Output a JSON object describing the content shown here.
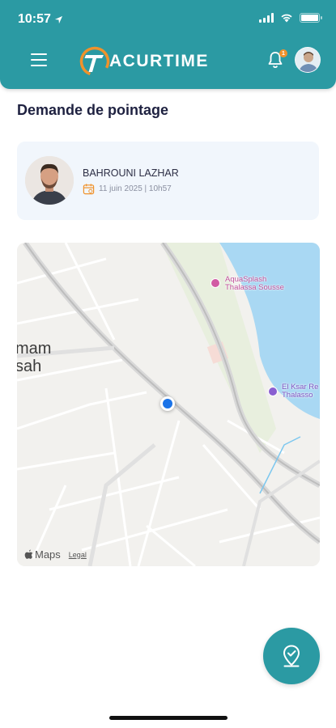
{
  "status_bar": {
    "time": "10:57"
  },
  "header": {
    "logo_text": "ACURTIME",
    "notification_count": "1"
  },
  "page": {
    "title": "Demande de pointage"
  },
  "user": {
    "name": "BAHROUNI LAZHAR",
    "datetime": "11 juin 2025 | 10h57"
  },
  "map": {
    "place_label_line1": "mam",
    "place_label_line2": "sah",
    "poi_1_line1": "AquaSplash",
    "poi_1_line2": "Thalassa Sousse",
    "poi_2_line1": "El Ksar Re",
    "poi_2_line2": "Thalasso",
    "brand": "Maps",
    "legal": "Legal"
  },
  "colors": {
    "primary": "#2b9aa3",
    "accent": "#f0922b",
    "location": "#1a73e8",
    "water": "#a9d8f3"
  },
  "icons": [
    "location-arrow-icon",
    "menu-icon",
    "acurtime-logo-icon",
    "bell-icon",
    "calendar-icon",
    "apple-icon",
    "location-check-icon"
  ]
}
